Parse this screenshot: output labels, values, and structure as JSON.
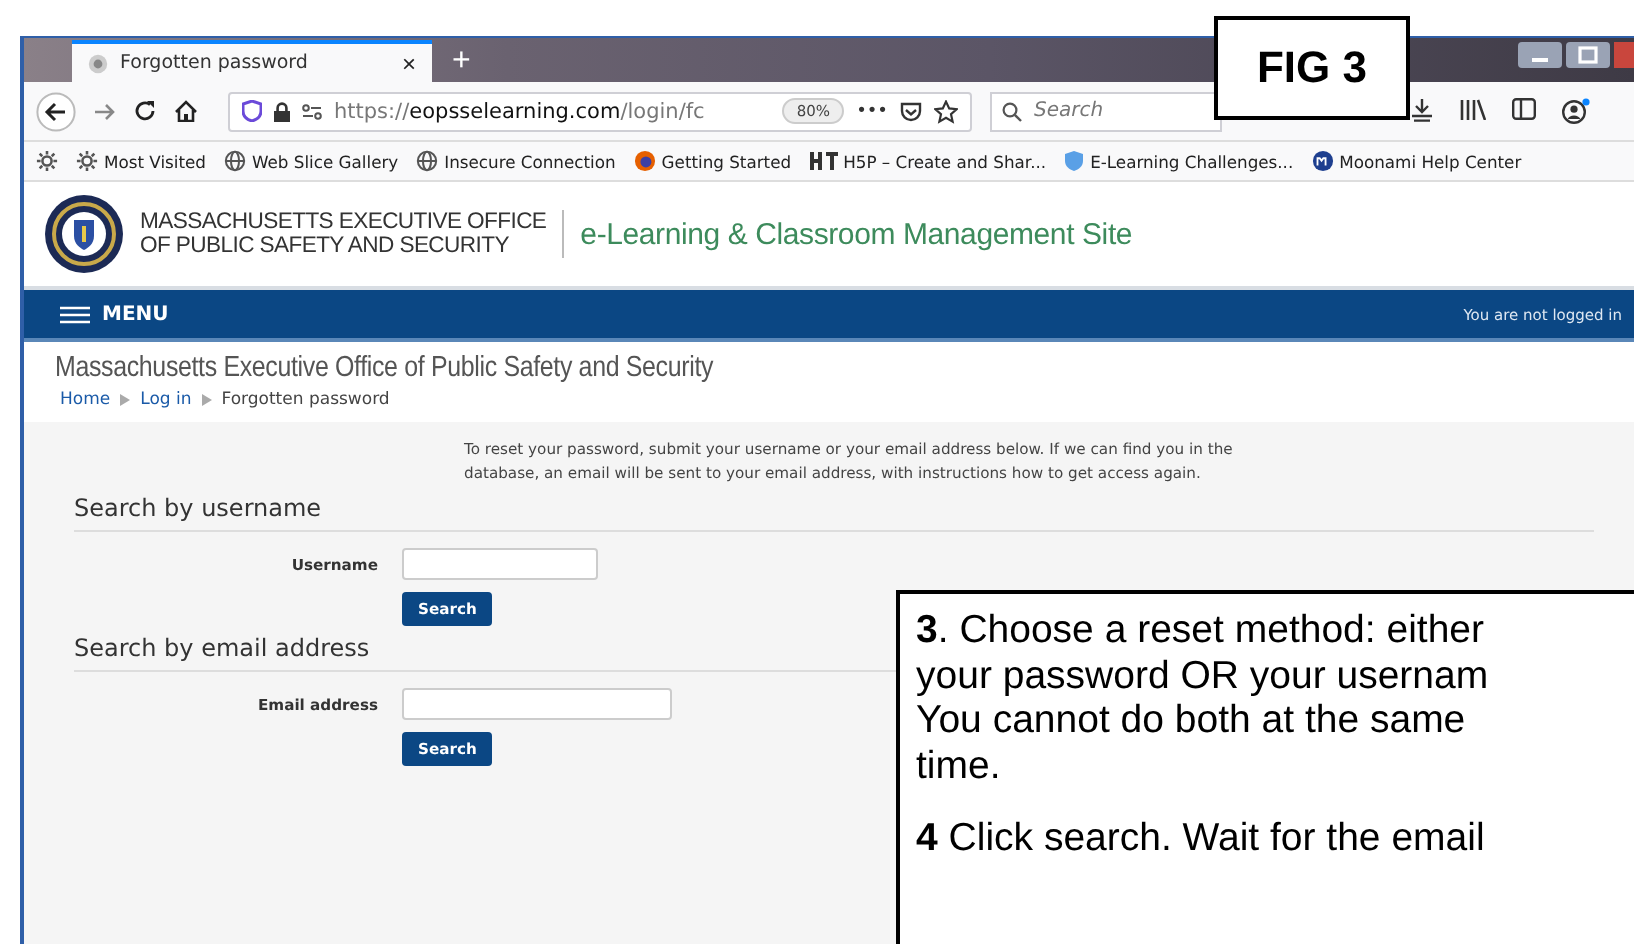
{
  "annotation_label": "FIG 3",
  "browser": {
    "tabs": [
      {
        "title": "Forgotten password",
        "close": "×",
        "selected": true
      }
    ],
    "new_tab": "+",
    "url": {
      "scheme": "https://",
      "domain": "eopsselearning.com",
      "path": "/login/fc"
    },
    "zoom": "80%",
    "more": "•••",
    "search": {
      "placeholder": "Search"
    },
    "bookmarks": [
      {
        "label": "Most Visited",
        "kind": "gear"
      },
      {
        "label": "Web Slice Gallery",
        "kind": "globe"
      },
      {
        "label": "Insecure Connection",
        "kind": "globe"
      },
      {
        "label": "Getting Started",
        "kind": "firefox"
      },
      {
        "label": "H5P – Create and Shar...",
        "kind": "h5p"
      },
      {
        "label": "E-Learning Challenges...",
        "kind": "shield"
      },
      {
        "label": "Moonami Help Center",
        "kind": "moonami"
      }
    ]
  },
  "site": {
    "org_lines": [
      "MASSACHUSETTS EXECUTIVE OFFICE",
      "OF PUBLIC SAFETY AND SECURITY"
    ],
    "site_name": "e-Learning & Classroom Management Site",
    "menu": "MENU",
    "login_status": "You are not logged in",
    "page_title": "Massachusetts Executive Office of Public Safety and Security",
    "breadcrumb": [
      {
        "label": "Home",
        "link": true
      },
      {
        "label": "Log in",
        "link": true
      },
      {
        "label": "Forgotten password",
        "link": false
      }
    ],
    "intro": "To reset your password, submit your username or your email address below. If we can find you in the database, an email will be sent to your email address, with instructions how to get access again.",
    "sections": [
      {
        "heading": "Search by username",
        "label": "Username",
        "kind": "username",
        "button": "Search"
      },
      {
        "heading": "Search by email address",
        "label": "Email address",
        "kind": "email",
        "button": "Search"
      }
    ]
  },
  "callout": {
    "paragraphs": [
      [
        "**3**. Choose a reset method: either",
        "your password OR your usernam",
        "You cannot do both at the same",
        "time."
      ],
      [
        "**4** Click search. Wait for the email"
      ]
    ]
  }
}
